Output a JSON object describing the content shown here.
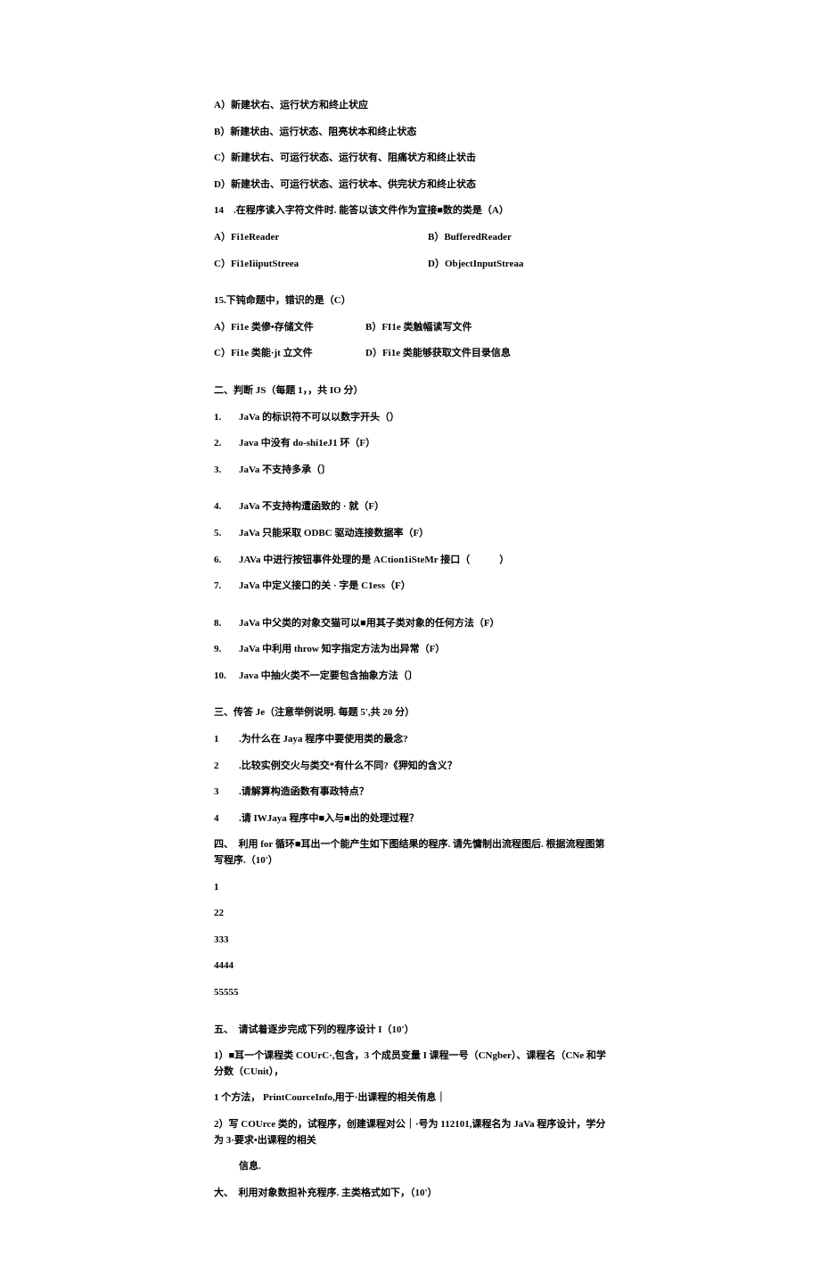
{
  "q13": {
    "a": "A）新建状右、运行状方和终止状应",
    "b": "B）新建状由、运行状态、阻亮状本和终止状态",
    "c": "C）新建状右、可运行状态、运行状有、阻痛状方和终止状击",
    "d": "D）新建状击、可运行状态、运行状本、供完状方和终止状态"
  },
  "q14": {
    "stem": "14　.在程序读入字符文件时. 能答以该文件作为宣接■数的类是（A）",
    "a": "A）Fi1eReader",
    "b": "B）BufferedReader",
    "c": "C）Fi1eIiiputStreea",
    "d": "D）ObjectInputStreaa"
  },
  "q15": {
    "stem": "15.下钝命题中，错识的是（C）",
    "a": "A）Fi1e 类傪•存储文件",
    "b": "B）FI1e 类触幅读写文件",
    "c": "C）Fi1e 类能·jt 立文件",
    "d": "D）Fi1e 类能够获取文件目录信息"
  },
  "section2": {
    "title": "二、判断 JS（每题 1，，共 IO 分）",
    "items": [
      "JaVa 的标识符不可以以数字开头（）",
      "Java 中没有 do-shi1eJ1 环（F）",
      "JaVa 不支持多承（〕",
      "JaVa 不支持构遭函致的 · 就（F）",
      "JaVa 只能采取 ODBC 驱动连接数据率（F）",
      "JAVa 中进行按钮事件处理的是 ACtion1iSteMr 接口（　　　）",
      "JaVa 中定义接口的关 · 字是 C1ess（F）",
      "JaVa 中父类的对象交猫可以■用其子类对象的任何方法（F）",
      "JaVa 中利用 throw 知字指定方法为出异常（F）",
      "Java 中抽火类不一定要包含抽象方法（〕"
    ]
  },
  "section3": {
    "title": "三、传答 Je（注意举例说明. 每题 5',共 20 分）",
    "items": [
      ".为什么在 Jaya 程序中要使用类的最念?",
      ".比较实例交火与类交*有什么不同?《狎知的含义？",
      ".请解算构造函数有事政特点？",
      ".请 IWJaya 程序中■入与■出的处理过程？"
    ]
  },
  "section4": {
    "title": "四、　利用 for 循环■耳出一个能产生如下图结果的程序. 请先慵制出流程图后. 根据流程图第写程序.（10'）",
    "rows": [
      "1",
      "22",
      "333",
      "4444",
      "55555"
    ]
  },
  "section5": {
    "title": "五、　请试着逐步完成下列的程序设计 I（10'）",
    "p1": "1）■耳一个课程类 COUrC·,包含，3 个成员变量 I 课程一号（CNgber）、课程名（CNe 和学分数（CUnit），",
    "p2": "1 个方法， PrintCourceInfo,用于·出课程的相关侑息｜",
    "p3": "2）写 COUrce 类的，试程序，创建课程对公｜·号为 112101,课程名为 JaVa 程序设计，学分为 3·要求•出课程的相关",
    "p3b": "信息.",
    "p4": "大、　利用对象数担补充程序. 主类格式如下，（10'）"
  }
}
